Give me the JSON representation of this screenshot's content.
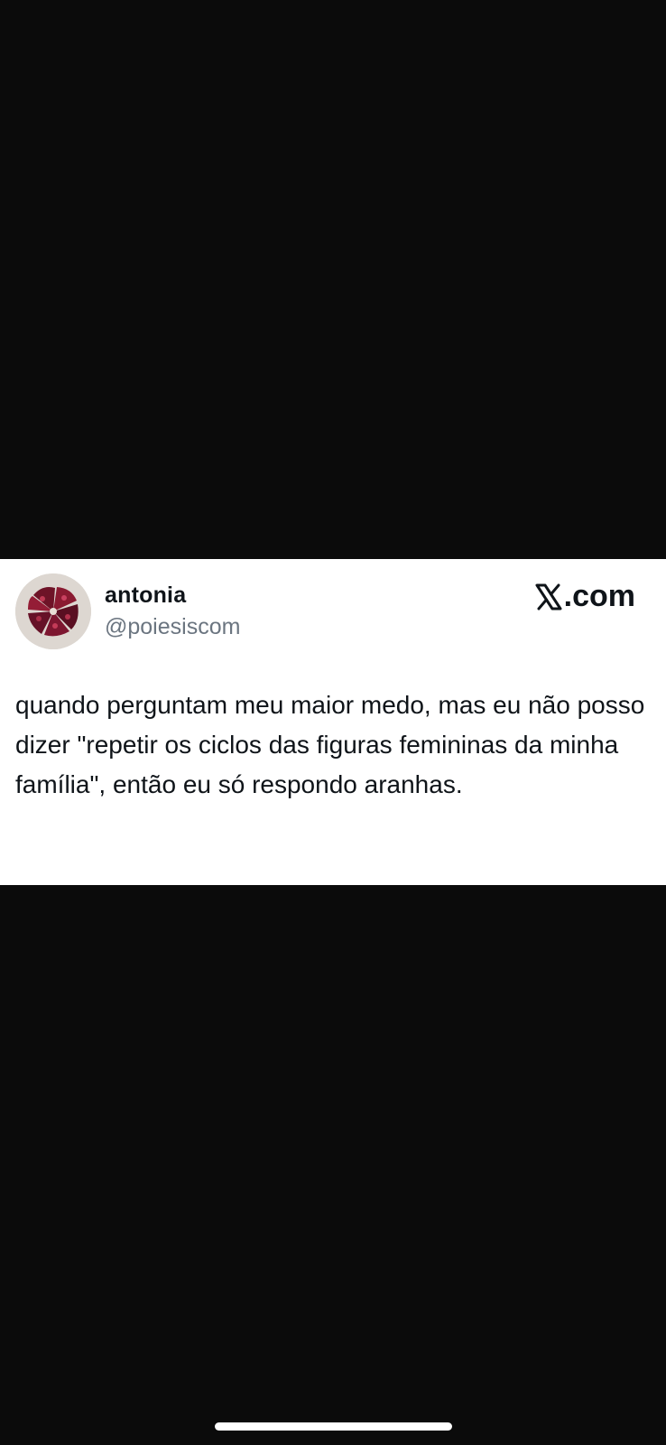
{
  "tweet": {
    "display_name": "antonia",
    "handle": "@poiesiscom",
    "brand": ".com",
    "text": "quando perguntam meu maior medo, mas eu não posso dizer \"repetir os ciclos das figuras femininas da minha família\", então eu só respondo aranhas."
  },
  "icons": {
    "brand_logo": "x-logo-icon",
    "avatar": "avatar-image"
  },
  "colors": {
    "background": "#0b0b0b",
    "card": "#ffffff",
    "text": "#0f1419",
    "handle": "#6b7580"
  }
}
